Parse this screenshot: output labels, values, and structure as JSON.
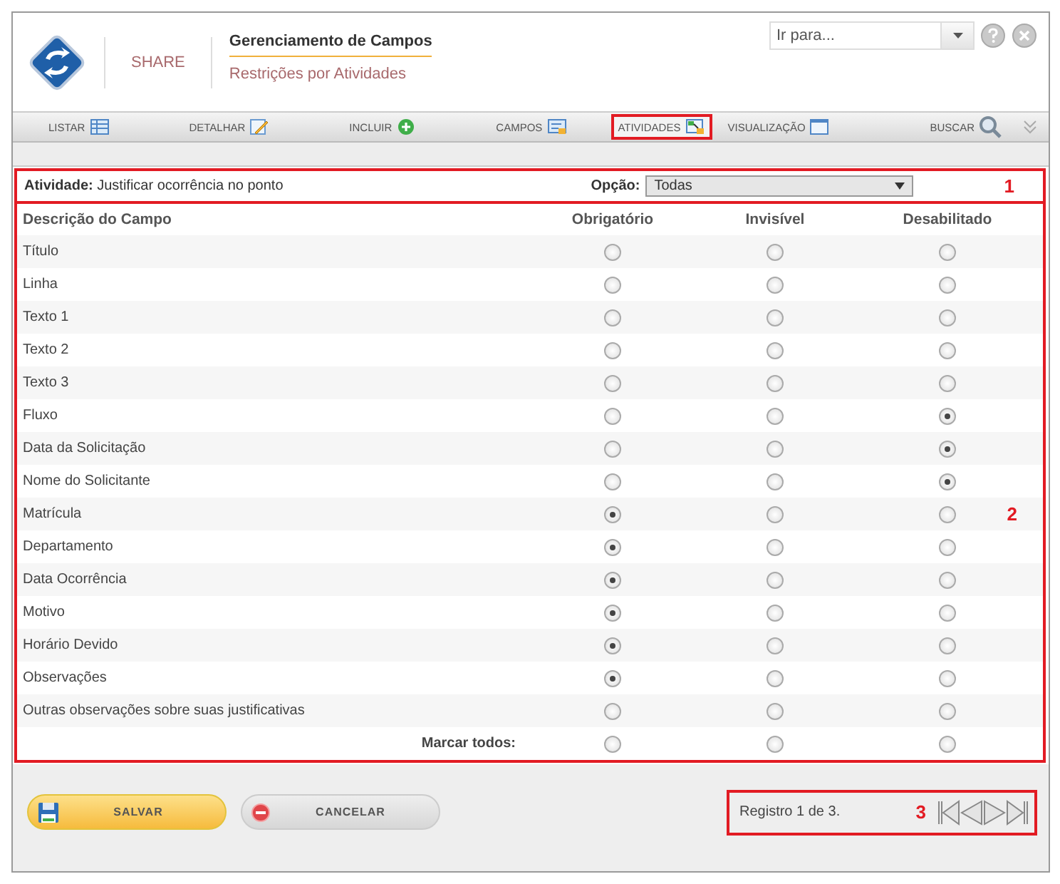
{
  "header": {
    "brand": "SHARE",
    "title": "Gerenciamento de Campos",
    "subtitle": "Restrições por Atividades",
    "goto": {
      "placeholder": "Ir para..."
    }
  },
  "toolbar": {
    "tabs": [
      {
        "label": "LISTAR",
        "kind": "list",
        "selected": false,
        "highlighted": false
      },
      {
        "label": "DETALHAR",
        "kind": "edit",
        "selected": false,
        "highlighted": false
      },
      {
        "label": "INCLUIR",
        "kind": "add",
        "selected": false,
        "highlighted": false
      },
      {
        "label": "CAMPOS",
        "kind": "fields",
        "selected": false,
        "highlighted": false
      },
      {
        "label": "ATIVIDADES",
        "kind": "activities",
        "selected": true,
        "highlighted": true
      },
      {
        "label": "VISUALIZAÇÃO",
        "kind": "view",
        "selected": false,
        "highlighted": false
      }
    ],
    "search": "BUSCAR"
  },
  "activity_bar": {
    "label": "Atividade:",
    "value": "Justificar ocorrência no ponto",
    "option_label": "Opção:",
    "option_value": "Todas",
    "annotation": "1"
  },
  "table": {
    "annotation": "2",
    "columns": [
      "Descrição do Campo",
      "Obrigatório",
      "Invisível",
      "Desabilitado"
    ],
    "rows": [
      {
        "name": "Título",
        "options": [
          {
            "selected": false
          },
          {
            "selected": false
          },
          {
            "selected": false
          }
        ]
      },
      {
        "name": "Linha",
        "options": [
          {
            "selected": false
          },
          {
            "selected": false
          },
          {
            "selected": false
          }
        ]
      },
      {
        "name": "Texto 1",
        "options": [
          {
            "selected": false
          },
          {
            "selected": false
          },
          {
            "selected": false
          }
        ]
      },
      {
        "name": "Texto 2",
        "options": [
          {
            "selected": false
          },
          {
            "selected": false
          },
          {
            "selected": false
          }
        ]
      },
      {
        "name": "Texto 3",
        "options": [
          {
            "selected": false
          },
          {
            "selected": false
          },
          {
            "selected": false
          }
        ]
      },
      {
        "name": "Fluxo",
        "options": [
          {
            "selected": false
          },
          {
            "selected": false
          },
          {
            "selected": true
          }
        ]
      },
      {
        "name": "Data da Solicitação",
        "options": [
          {
            "selected": false
          },
          {
            "selected": false
          },
          {
            "selected": true
          }
        ]
      },
      {
        "name": "Nome do Solicitante",
        "options": [
          {
            "selected": false
          },
          {
            "selected": false
          },
          {
            "selected": true
          }
        ]
      },
      {
        "name": "Matrícula",
        "options": [
          {
            "selected": true
          },
          {
            "selected": false
          },
          {
            "selected": false
          }
        ]
      },
      {
        "name": "Departamento",
        "options": [
          {
            "selected": true
          },
          {
            "selected": false
          },
          {
            "selected": false
          }
        ]
      },
      {
        "name": "Data Ocorrência",
        "options": [
          {
            "selected": true
          },
          {
            "selected": false
          },
          {
            "selected": false
          }
        ]
      },
      {
        "name": "Motivo",
        "options": [
          {
            "selected": true
          },
          {
            "selected": false
          },
          {
            "selected": false
          }
        ]
      },
      {
        "name": "Horário Devido",
        "options": [
          {
            "selected": true
          },
          {
            "selected": false
          },
          {
            "selected": false
          }
        ]
      },
      {
        "name": "Observações",
        "options": [
          {
            "selected": true
          },
          {
            "selected": false
          },
          {
            "selected": false
          }
        ]
      },
      {
        "name": "Outras observações sobre suas justificativas",
        "options": [
          {
            "selected": false
          },
          {
            "selected": false
          },
          {
            "selected": false
          }
        ]
      }
    ],
    "mark_all": {
      "label": "Marcar todos:",
      "options": [
        {
          "selected": false
        },
        {
          "selected": false
        },
        {
          "selected": false
        }
      ]
    }
  },
  "footer": {
    "save": "SALVAR",
    "cancel": "CANCELAR",
    "pager": {
      "text": "Registro 1 de 3.",
      "annotation": "3"
    }
  }
}
